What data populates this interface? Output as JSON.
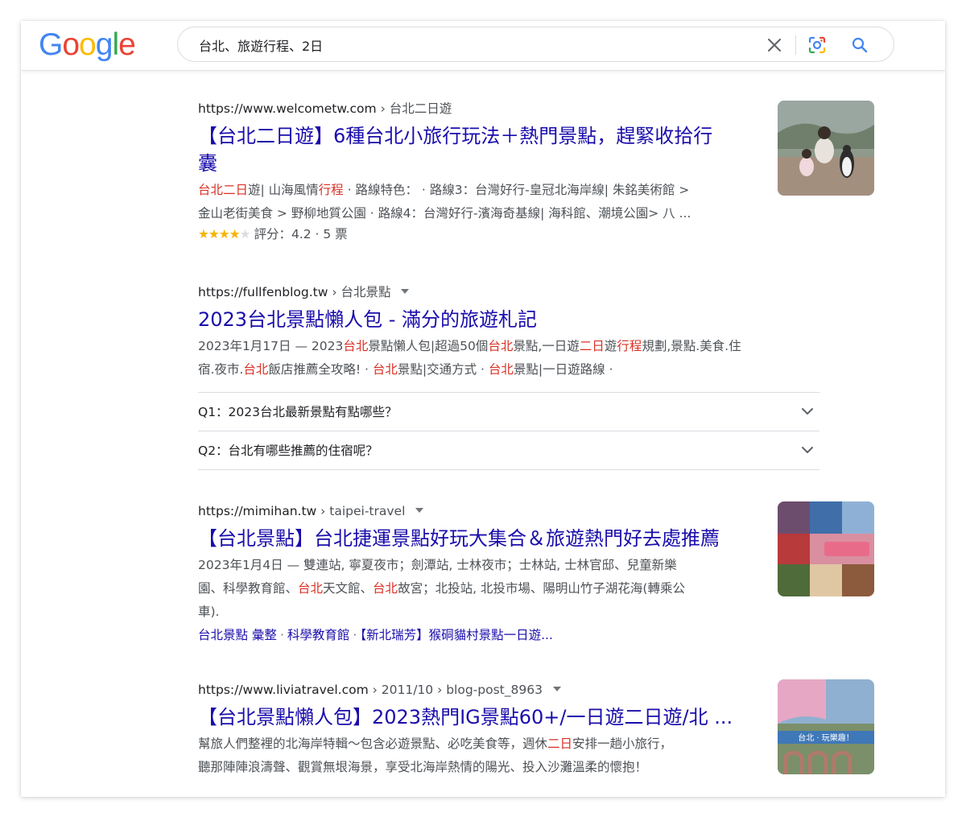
{
  "header": {
    "logo_letters": [
      {
        "ch": "G",
        "color": "#4285F4"
      },
      {
        "ch": "o",
        "color": "#EA4335"
      },
      {
        "ch": "o",
        "color": "#FBBC05"
      },
      {
        "ch": "g",
        "color": "#4285F4"
      },
      {
        "ch": "l",
        "color": "#34A853"
      },
      {
        "ch": "e",
        "color": "#EA4335"
      }
    ],
    "search_query": "台北、旅遊行程、2日"
  },
  "results": [
    {
      "site": "https://www.welcometw.com",
      "path": "› 台北二日遊",
      "title_line1": "【台北二日遊】6種台北小旅行玩法＋熱門景點，趕緊收拾行",
      "title_line2": "囊",
      "snippet_l1_hl1": "台北二日",
      "snippet_l1_t1": "遊| 山海風情",
      "snippet_l1_hl2": "行程",
      "snippet_l1_t2": " · 路線特色： · 路線3：台灣好行-皇冠北海岸線| 朱銘美術館 >",
      "snippet_l2": "金山老街美食 > 野柳地質公園 · 路線4：台灣好行-濱海奇基線| 海科館、潮境公園> 八 ...",
      "rating_stars": 4,
      "rating_text": "評分：4.2 · 5 票"
    },
    {
      "site": "https://fullfenblog.tw",
      "path": "› 台北景點",
      "title": "2023台北景點懶人包 - 滿分的旅遊札記",
      "s1_a": "2023年1月17日 — 2023",
      "s1_hl1": "台北",
      "s1_b": "景點懶人包|超過50個",
      "s1_hl2": "台北",
      "s1_c": "景點,一日遊",
      "s1_hl3": "二日",
      "s1_d": "遊",
      "s1_hl4": "行程",
      "s1_e": "規劃,景點.美食.住",
      "s2_a": "宿.夜市.",
      "s2_hl1": "台北",
      "s2_b": "飯店推薦全攻略! · ",
      "s2_hl2": "台北",
      "s2_c": "景點|交通方式 · ",
      "s2_hl3": "台北",
      "s2_d": "景點|一日遊路線 ·",
      "faq": [
        "Q1：2023台北最新景點有點哪些？",
        "Q2：台北有哪些推薦的住宿呢？"
      ]
    },
    {
      "site": "https://mimihan.tw",
      "path": "› taipei-travel",
      "title": "【台北景點】台北捷運景點好玩大集合＆旅遊熱門好去處推薦",
      "s1": "2023年1月4日 — 雙連站, 寧夏夜市；劍潭站, 士林夜市；士林站, 士林官邸、兒童新樂",
      "s2_a": "園、科學教育館、",
      "s2_hl1": "台北",
      "s2_b": "天文館、",
      "s2_hl2": "台北",
      "s2_c": "故宮；北投站, 北投市場、陽明山竹子湖花海(轉乘公",
      "s3": "車).",
      "sublinks": [
        "台北景點 彙整",
        "科學教育館",
        "【新北瑞芳】猴硐貓村景點一日遊..."
      ]
    },
    {
      "site": "https://www.liviatravel.com",
      "path": "› 2011/10 › blog-post_8963",
      "title": "【台北景點懶人包】2023熱門IG景點60+/一日遊二日遊/北 ...",
      "s1_a": "幫旅人們整裡的北海岸特輯～包含必遊景點、必吃美食等，週休",
      "s1_hl": "二日",
      "s1_b": "安排一趟小旅行，",
      "s2": "聽那陣陣浪濤聲、觀賞無垠海景，享受北海岸熱情的陽光、投入沙灘溫柔的懷抱！",
      "thumb_caption_a": "台北 · 玩樂趣！"
    }
  ]
}
